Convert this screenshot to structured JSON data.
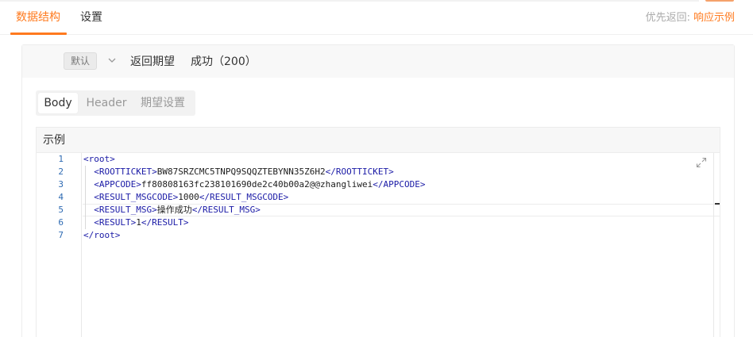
{
  "tabs": [
    {
      "label": "数据结构",
      "active": true
    },
    {
      "label": "设置",
      "active": false
    }
  ],
  "preference": {
    "label": "优先返回:",
    "link": "响应示例"
  },
  "response": {
    "badge": "默认",
    "expectation": "返回期望",
    "status": "成功（200）"
  },
  "segments": [
    {
      "label": "Body",
      "active": true
    },
    {
      "label": "Header",
      "active": false
    },
    {
      "label": "期望设置",
      "active": false
    }
  ],
  "example": {
    "title": "示例",
    "lines": [
      {
        "num": "1",
        "indent": "",
        "open": "<root>",
        "text": "",
        "close": ""
      },
      {
        "num": "2",
        "indent": "  ",
        "open": "<ROOTTICKET>",
        "text": "BW87SRZCMC5TNPQ9SQQZTEBYNN35Z6H2",
        "close": "</ROOTTICKET>"
      },
      {
        "num": "3",
        "indent": "  ",
        "open": "<APPCODE>",
        "text": "ff80808163fc238101690de2c40b00a2@@zhangliwei",
        "close": "</APPCODE>"
      },
      {
        "num": "4",
        "indent": "  ",
        "open": "<RESULT_MSGCODE>",
        "text": "1000",
        "close": "</RESULT_MSGCODE>"
      },
      {
        "num": "5",
        "indent": "  ",
        "open": "<RESULT_MSG>",
        "text": "操作成功",
        "close": "</RESULT_MSG>"
      },
      {
        "num": "6",
        "indent": "  ",
        "open": "<RESULT>",
        "text": "1",
        "close": "</RESULT>"
      },
      {
        "num": "7",
        "indent": "",
        "open": "</root>",
        "text": "",
        "close": ""
      }
    ]
  },
  "colors": {
    "accent": "#ff7a1e",
    "line_number": "#2f6bb3",
    "xml_tag": "#1a1aa6"
  },
  "icons": {
    "dropdown": "chevron-down-icon",
    "expand": "expand-icon"
  }
}
